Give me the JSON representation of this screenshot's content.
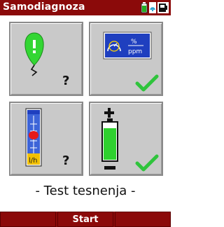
{
  "header": {
    "title": "Samodiagnoza",
    "icons": [
      "battery-icon",
      "signal-icon",
      "device-icon"
    ]
  },
  "tiles": [
    {
      "name": "tile-pump-check",
      "icon": "green-pin-exclamation-icon",
      "status": "?",
      "status_icon": "question-mark-icon"
    },
    {
      "name": "tile-sensor-check",
      "icon": "sensor-ppm-display-icon",
      "unit_top": "%",
      "unit_bottom": "ppm",
      "status_icon": "check-mark-icon"
    },
    {
      "name": "tile-flow-check",
      "icon": "flow-meter-icon",
      "unit": "l/h",
      "status": "?",
      "status_icon": "question-mark-icon"
    },
    {
      "name": "tile-battery-check",
      "icon": "battery-charge-icon",
      "plus": "+",
      "minus": "−",
      "status_icon": "check-mark-icon"
    }
  ],
  "main": {
    "caption": "- Test tesnenja -"
  },
  "softkeys": {
    "left": "",
    "center": "Start",
    "right": ""
  },
  "colors": {
    "accent": "#8b0a0a",
    "tile_bg": "#c9c9c9",
    "check_green": "#2fc43c",
    "pin_green": "#33d633",
    "display_blue": "#1f3fbf"
  }
}
